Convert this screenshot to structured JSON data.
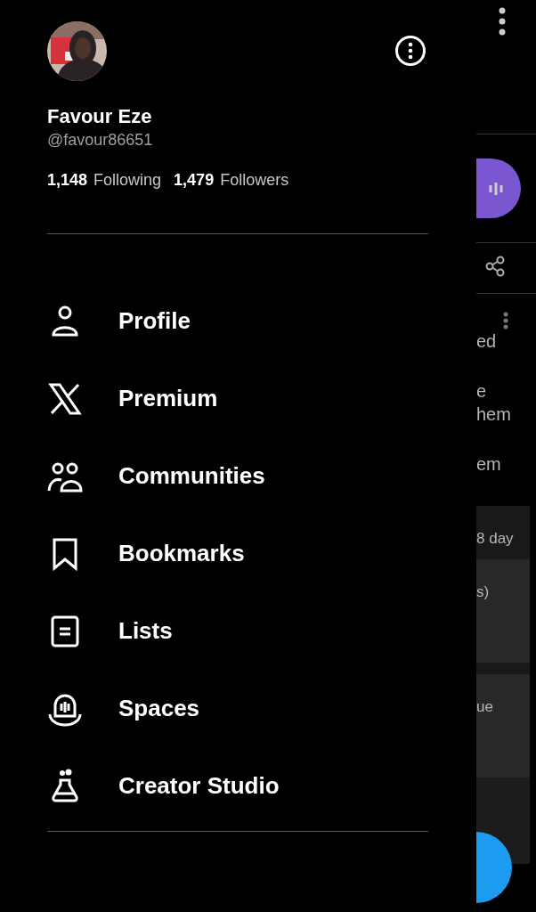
{
  "profile": {
    "name": "Favour Eze",
    "handle": "@favour86651",
    "following_count": "1,148",
    "following_label": "Following",
    "followers_count": "1,479",
    "followers_label": "Followers"
  },
  "menu": [
    {
      "label": "Profile"
    },
    {
      "label": "Premium"
    },
    {
      "label": "Communities"
    },
    {
      "label": "Bookmarks"
    },
    {
      "label": "Lists"
    },
    {
      "label": "Spaces"
    },
    {
      "label": "Creator Studio"
    }
  ],
  "background": {
    "post_texts": [
      "ed",
      "e",
      "hem",
      "em"
    ],
    "card_texts": [
      "8 day",
      "s)",
      "ue"
    ]
  }
}
